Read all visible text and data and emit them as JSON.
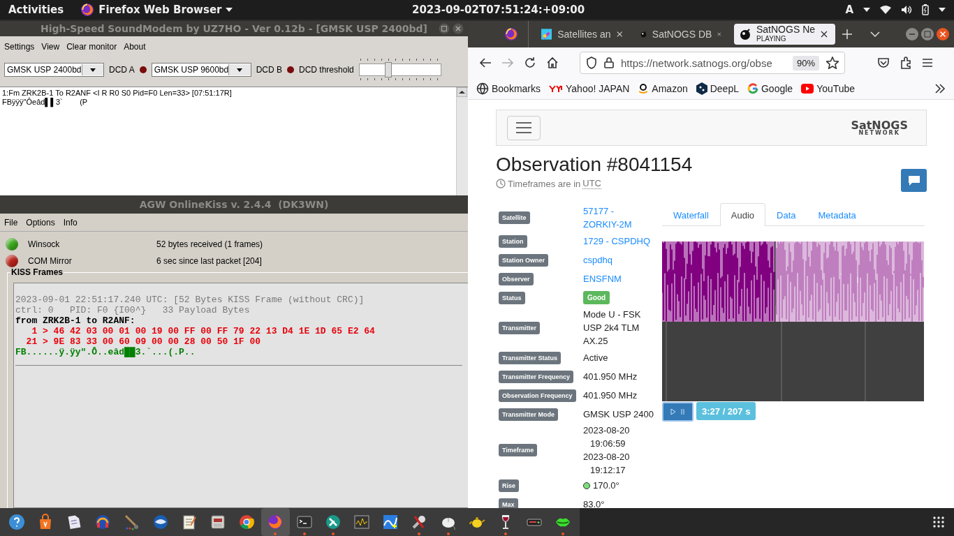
{
  "top_bar": {
    "activities": "Activities",
    "app_menu": "Firefox Web Browser",
    "clock": "2023-09-02T07:51:24:+09:00",
    "input_source": "A"
  },
  "soundmodem": {
    "title": "High-Speed SoundModem by UZ7HO - Ver 0.12b - [GMSK USP 2400bd]",
    "menu": [
      "Settings",
      "View",
      "Clear monitor",
      "About"
    ],
    "modem_a": "GMSK USP 2400bd",
    "dcd_a": {
      "label": "DCD A",
      "on": false
    },
    "modem_b": "GMSK USP 9600bd",
    "dcd_b": {
      "label": "DCD B",
      "on": false
    },
    "threshold": {
      "label": "DCD threshold",
      "level": 0.34
    },
    "monitor_lines": [
      "1:Fm ZRK2B-1 To R2ANF <I R R0 S0 Pid=F0 Len=33> [07:51:17R]",
      "FBÿÿÿ\"Ôeâd▌▌3`        (P"
    ]
  },
  "agw": {
    "title": "AGW OnlineKiss v. 2.4.4  (DK3WN)",
    "menu": [
      "File",
      "Options",
      "Info"
    ],
    "indicators": [
      {
        "name": "Winsock",
        "info": "52 bytes received (1 frames)",
        "color": "#3fae1f"
      },
      {
        "name": "COM Mirror",
        "info": "6 sec since last packet [204]",
        "color": "#c0241b"
      }
    ],
    "frames_title": "KISS Frames",
    "frames": [
      {
        "kind": "header",
        "text": "2023-09-01 22:51:17.240 UTC: [52 Bytes KISS Frame (without CRC)]"
      },
      {
        "kind": "header",
        "text": "ctrl: 0   PID: F0 {I00^}   33 Payload Bytes"
      },
      {
        "kind": "address",
        "text": "from ZRK2B-1 to R2ANF:"
      },
      {
        "kind": "hex",
        "text": "   1 > 46 42 03 00 01 00 19 00 FF 00 FF 79 22 13 D4 1E 1D 65 E2 64"
      },
      {
        "kind": "hex",
        "text": "  21 > 9E 83 33 00 60 09 00 00 28 00 50 1F 00"
      },
      {
        "kind": "ascii",
        "text": "FB......ÿ.ÿy\".Ô..eâd██3.`...(.P.."
      }
    ]
  },
  "firefox": {
    "tabs": [
      {
        "label": "Satellites an",
        "selected": false
      },
      {
        "label": "SatNOGS DB",
        "selected": false
      },
      {
        "label": "SatNOGS Ne",
        "status": "PLAYING",
        "selected": true
      }
    ],
    "url": "https://network.satnogs.org/obse",
    "zoom": "90%",
    "bookmarks": [
      "Bookmarks",
      "Yahoo! JAPAN",
      "Amazon",
      "DeepL",
      "Google",
      "YouTube"
    ]
  },
  "page": {
    "logo": "SatNOGS",
    "logo_sub": "NETWORK",
    "title": "Observation #8041154",
    "tz_note": "Timeframes are in",
    "tz": "UTC",
    "details": [
      {
        "label": "Satellite",
        "kind": "link",
        "values": [
          "57177 - ZORKIY-2M"
        ]
      },
      {
        "label": "Station",
        "kind": "link",
        "values": [
          "1729 - CSPDHQ"
        ]
      },
      {
        "label": "Station Owner",
        "kind": "link",
        "values": [
          "cspdhq"
        ]
      },
      {
        "label": "Observer",
        "kind": "link",
        "values": [
          "ENSFNM"
        ]
      },
      {
        "label": "Status",
        "kind": "badge",
        "values": [
          "Good"
        ]
      },
      {
        "label": "Transmitter",
        "kind": "text",
        "values": [
          "Mode U - FSK USP 2k4 TLM AX.25"
        ]
      },
      {
        "label": "Transmitter Status",
        "kind": "text",
        "values": [
          "Active"
        ]
      },
      {
        "label": "Transmitter Frequency",
        "kind": "text",
        "values": [
          "401.950 MHz"
        ]
      },
      {
        "label": "Observation Frequency",
        "kind": "text",
        "values": [
          "401.950 MHz"
        ]
      },
      {
        "label": "Transmitter Mode",
        "kind": "text",
        "values": [
          "GMSK USP 2400"
        ]
      },
      {
        "label": "Timeframe",
        "kind": "text",
        "values": [
          "2023-08-20 19:06:59",
          "2023-08-20 19:12:17"
        ]
      },
      {
        "label": "Rise",
        "kind": "dot",
        "values": [
          "170.0°"
        ]
      },
      {
        "label": "Max",
        "kind": "text",
        "values": [
          "83.0°"
        ]
      }
    ],
    "tabs": [
      {
        "label": "Waterfall",
        "selected": false
      },
      {
        "label": "Audio",
        "selected": true
      },
      {
        "label": "Data",
        "selected": false
      },
      {
        "label": "Metadata",
        "selected": false
      }
    ],
    "audio": {
      "progress": {
        "level": 0.43
      },
      "time": "3:27 / 207 s"
    }
  },
  "dock": [
    {
      "running": false,
      "selected": false
    },
    {
      "running": false,
      "selected": false
    },
    {
      "running": false,
      "selected": false
    },
    {
      "running": false,
      "selected": false
    },
    {
      "running": false,
      "selected": false
    },
    {
      "running": false,
      "selected": false
    },
    {
      "running": false,
      "selected": false
    },
    {
      "running": false,
      "selected": false
    },
    {
      "running": false,
      "selected": false
    },
    {
      "running": true,
      "selected": true
    },
    {
      "running": true,
      "selected": false
    },
    {
      "running": true,
      "selected": false
    },
    {
      "running": false,
      "selected": false
    },
    {
      "running": false,
      "selected": false
    },
    {
      "running": true,
      "selected": false
    },
    {
      "running": true,
      "selected": false
    },
    {
      "running": false,
      "selected": false
    },
    {
      "running": true,
      "selected": false
    },
    {
      "running": false,
      "selected": false
    },
    {
      "running": true,
      "selected": false
    }
  ]
}
